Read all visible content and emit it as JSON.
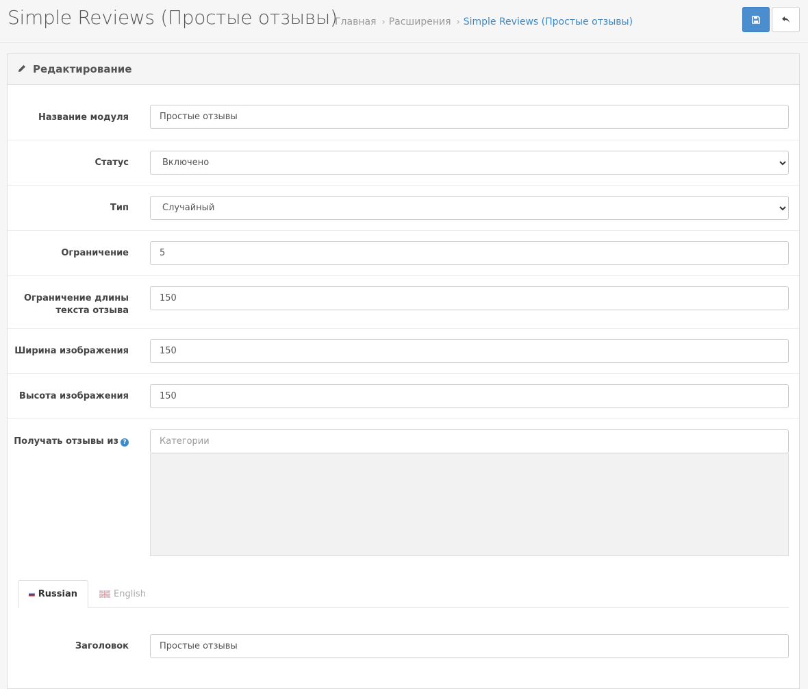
{
  "header": {
    "title": "Simple Reviews (Простые отзывы)",
    "breadcrumbs": [
      {
        "label": "Главная"
      },
      {
        "label": "Расширения"
      },
      {
        "label": "Simple Reviews (Простые отзывы)"
      }
    ],
    "save_icon": "save-icon",
    "back_icon": "reply-icon"
  },
  "panel": {
    "title": "Редактирование",
    "icon": "pencil-icon"
  },
  "form": {
    "module_name": {
      "label": "Название модуля",
      "value": "Простые отзывы"
    },
    "status": {
      "label": "Статус",
      "value": "Включено"
    },
    "type": {
      "label": "Тип",
      "value": "Случайный"
    },
    "limit": {
      "label": "Ограничение",
      "value": "5"
    },
    "text_limit": {
      "label": "Ограничение длины текста отзыва",
      "value": "150"
    },
    "image_width": {
      "label": "Ширина изображения",
      "value": "150"
    },
    "image_height": {
      "label": "Высота изображения",
      "value": "150"
    },
    "source": {
      "label": "Получать отзывы из",
      "help_icon": "question-circle-icon",
      "placeholder": "Категории"
    }
  },
  "language_tabs": [
    {
      "label": "Russian",
      "active": true,
      "flag": "ru-flag-icon"
    },
    {
      "label": "English",
      "active": false,
      "flag": "gb-flag-icon"
    }
  ],
  "heading_field": {
    "label": "Заголовок",
    "value": "Простые отзывы"
  },
  "colors": {
    "primary": "#4a8ed0",
    "link": "#3d8ac9",
    "background": "#f6f6f6"
  }
}
